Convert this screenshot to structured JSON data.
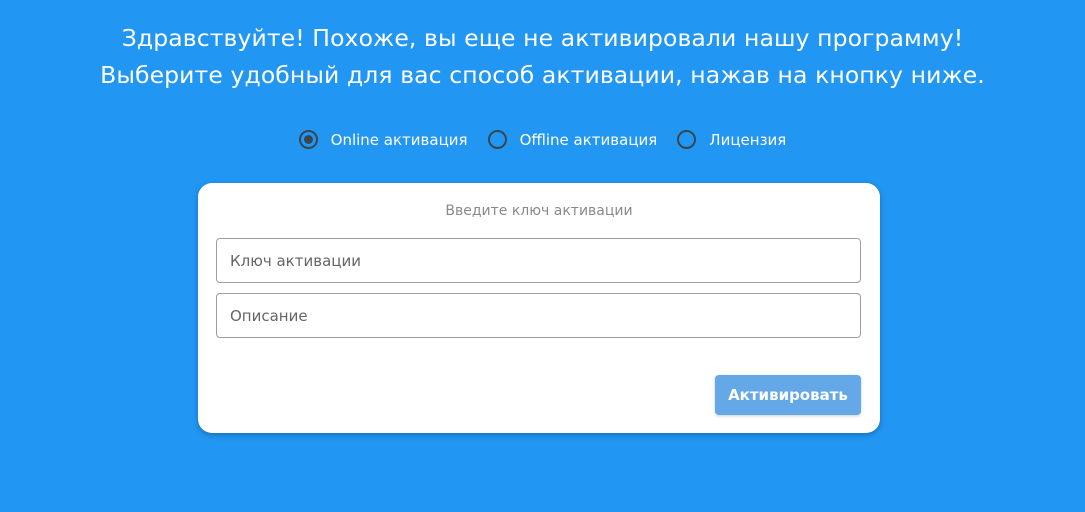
{
  "header": {
    "line1": "Здравствуйте! Похоже, вы еще не активировали нашу программу!",
    "line2": "Выберите удобный для вас способ активации, нажав на кнопку ниже."
  },
  "activation_modes": {
    "selected": "Online активация",
    "options": [
      {
        "label": "Online активация",
        "checked": true
      },
      {
        "label": "Offline активация",
        "checked": false
      },
      {
        "label": "Лицензия",
        "checked": false
      }
    ]
  },
  "form": {
    "title": "Введите ключ активации",
    "key_placeholder": "Ключ активации",
    "key_value": "",
    "description_placeholder": "Описание",
    "description_value": "",
    "submit_label": "Активировать"
  },
  "colors": {
    "background": "#2196f3",
    "card": "#ffffff",
    "button": "#64a8e8",
    "radio": "#37474f"
  }
}
